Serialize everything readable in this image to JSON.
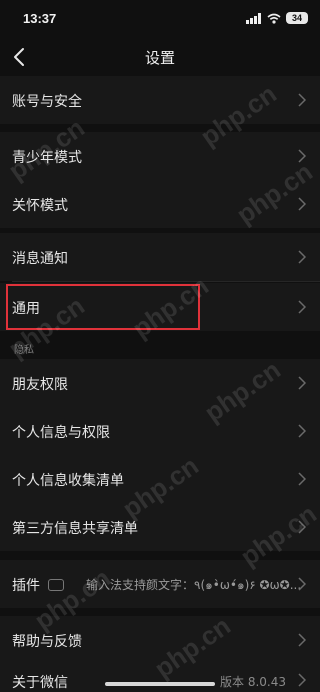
{
  "status_bar": {
    "time": "13:37",
    "battery": "34"
  },
  "nav": {
    "title": "设置"
  },
  "rows": [
    {
      "label": "账号与安全"
    },
    {
      "label": "青少年模式"
    },
    {
      "label": "关怀模式"
    },
    {
      "label": "消息通知"
    },
    {
      "label": "通用"
    }
  ],
  "section_privacy": {
    "title": "隐私"
  },
  "privacy_rows": [
    {
      "label": "朋友权限"
    },
    {
      "label": "个人信息与权限"
    },
    {
      "label": "个人信息收集清单"
    },
    {
      "label": "第三方信息共享清单"
    }
  ],
  "plugins_row": {
    "label": "插件",
    "preview": "输入法支持颜文字：٩(๑•̀ω•́๑)۶ ✪ω✪..."
  },
  "help_row": {
    "label": "帮助与反馈"
  },
  "about_row": {
    "label": "关于微信",
    "value": "版本 8.0.43"
  },
  "watermark": "php.cn",
  "colors": {
    "background": "#101010",
    "cell": "#181818",
    "highlight_border": "#e0323a"
  }
}
